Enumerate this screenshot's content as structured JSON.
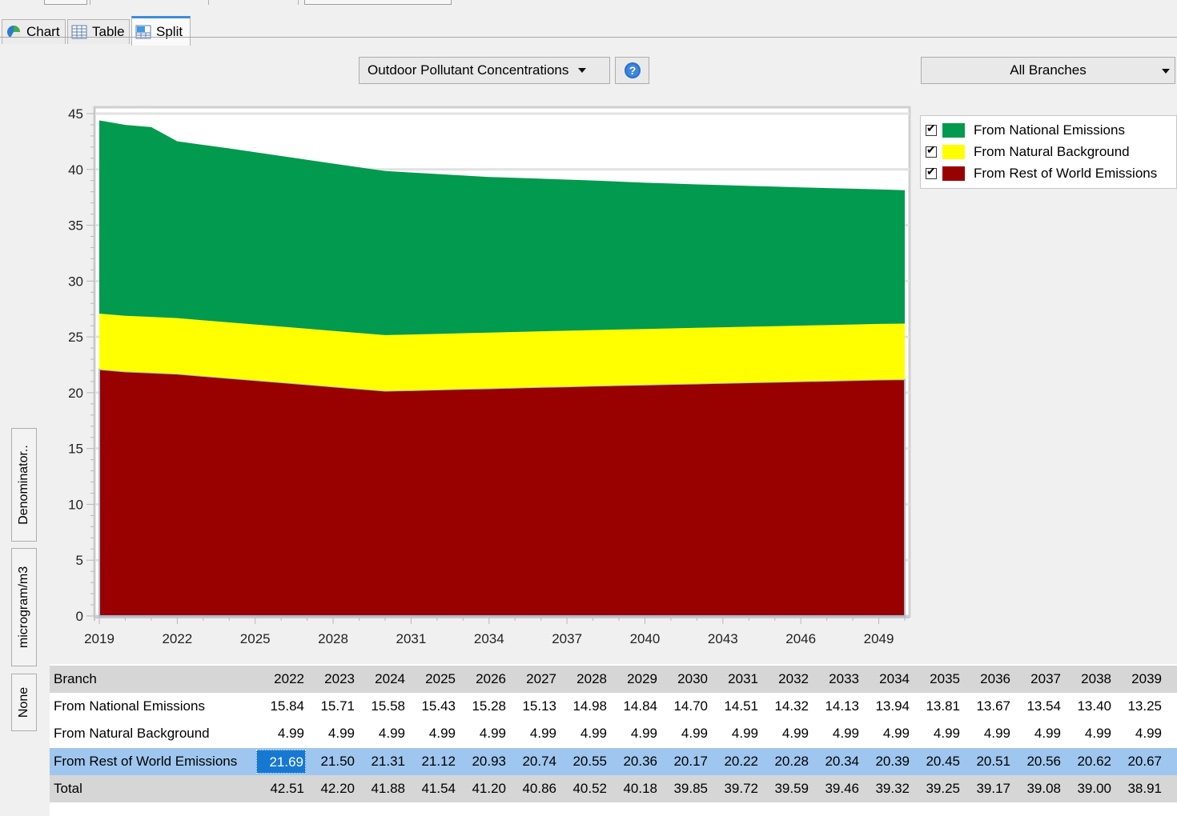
{
  "tabs": [
    {
      "label": "Chart",
      "icon": "chart-icon"
    },
    {
      "label": "Table",
      "icon": "table-icon"
    },
    {
      "label": "Split",
      "icon": "split-icon"
    }
  ],
  "active_tab": "Split",
  "indicator_select": {
    "value": "Outdoor Pollutant Concentrations"
  },
  "branch_select": {
    "value": "All Branches"
  },
  "help_icon": "question-icon",
  "side_tabs": {
    "denominator": "Denominator..",
    "unit": "microgram/m3",
    "none": "None"
  },
  "colors": {
    "national": "#029a4e",
    "natural": "#ffff00",
    "rest": "#990000"
  },
  "legend": [
    {
      "label": "From National Emissions",
      "color": "#029a4e",
      "checked": true
    },
    {
      "label": "From Natural Background",
      "color": "#ffff00",
      "checked": true
    },
    {
      "label": "From Rest of World Emissions",
      "color": "#990000",
      "checked": true
    }
  ],
  "chart_data": {
    "type": "area",
    "stacked": true,
    "x": [
      2019,
      2020,
      2021,
      2022,
      2023,
      2024,
      2025,
      2026,
      2027,
      2028,
      2029,
      2030,
      2031,
      2032,
      2033,
      2034,
      2035,
      2036,
      2037,
      2038,
      2039,
      2040,
      2041,
      2042,
      2043,
      2044,
      2045,
      2046,
      2047,
      2048,
      2049,
      2050
    ],
    "xticks": [
      2019,
      2022,
      2025,
      2028,
      2031,
      2034,
      2037,
      2040,
      2043,
      2046,
      2049
    ],
    "ylim": [
      0,
      45
    ],
    "yticks": [
      0,
      5,
      10,
      15,
      20,
      25,
      30,
      35,
      40,
      45
    ],
    "series": [
      {
        "name": "From Rest of World Emissions",
        "values": [
          22.1,
          21.9,
          21.8,
          21.69,
          21.5,
          21.31,
          21.12,
          20.93,
          20.74,
          20.55,
          20.36,
          20.17,
          20.22,
          20.28,
          20.34,
          20.39,
          20.45,
          20.51,
          20.56,
          20.62,
          20.67,
          20.72,
          20.77,
          20.82,
          20.87,
          20.92,
          20.97,
          21.02,
          21.07,
          21.12,
          21.17,
          21.2
        ]
      },
      {
        "name": "From Natural Background",
        "values": [
          4.99,
          4.99,
          4.99,
          4.99,
          4.99,
          4.99,
          4.99,
          4.99,
          4.99,
          4.99,
          4.99,
          4.99,
          4.99,
          4.99,
          4.99,
          4.99,
          4.99,
          4.99,
          4.99,
          4.99,
          4.99,
          4.99,
          4.99,
          4.99,
          4.99,
          4.99,
          4.99,
          4.99,
          4.99,
          4.99,
          4.99,
          4.99
        ]
      },
      {
        "name": "From National Emissions",
        "values": [
          17.3,
          17.1,
          17.0,
          15.84,
          15.71,
          15.58,
          15.43,
          15.28,
          15.13,
          14.98,
          14.84,
          14.7,
          14.51,
          14.32,
          14.13,
          13.94,
          13.81,
          13.67,
          13.54,
          13.4,
          13.25,
          13.1,
          12.98,
          12.85,
          12.74,
          12.61,
          12.5,
          12.38,
          12.27,
          12.16,
          12.05,
          11.95
        ]
      }
    ]
  },
  "table": {
    "header_label": "Branch",
    "years": [
      "2022",
      "2023",
      "2024",
      "2025",
      "2026",
      "2027",
      "2028",
      "2029",
      "2030",
      "2031",
      "2032",
      "2033",
      "2034",
      "2035",
      "2036",
      "2037",
      "2038",
      "2039"
    ],
    "rows": [
      {
        "name": "From National Emissions",
        "values": [
          "15.84",
          "15.71",
          "15.58",
          "15.43",
          "15.28",
          "15.13",
          "14.98",
          "14.84",
          "14.70",
          "14.51",
          "14.32",
          "14.13",
          "13.94",
          "13.81",
          "13.67",
          "13.54",
          "13.40",
          "13.25"
        ]
      },
      {
        "name": "From Natural Background",
        "values": [
          "4.99",
          "4.99",
          "4.99",
          "4.99",
          "4.99",
          "4.99",
          "4.99",
          "4.99",
          "4.99",
          "4.99",
          "4.99",
          "4.99",
          "4.99",
          "4.99",
          "4.99",
          "4.99",
          "4.99",
          "4.99"
        ]
      },
      {
        "name": "From Rest of World Emissions",
        "values": [
          "21.69",
          "21.50",
          "21.31",
          "21.12",
          "20.93",
          "20.74",
          "20.55",
          "20.36",
          "20.17",
          "20.22",
          "20.28",
          "20.34",
          "20.39",
          "20.45",
          "20.51",
          "20.56",
          "20.62",
          "20.67"
        ]
      },
      {
        "name": "Total",
        "values": [
          "42.51",
          "42.20",
          "41.88",
          "41.54",
          "41.20",
          "40.86",
          "40.52",
          "40.18",
          "39.85",
          "39.72",
          "39.59",
          "39.46",
          "39.32",
          "39.25",
          "39.17",
          "39.08",
          "39.00",
          "38.91"
        ]
      }
    ]
  }
}
